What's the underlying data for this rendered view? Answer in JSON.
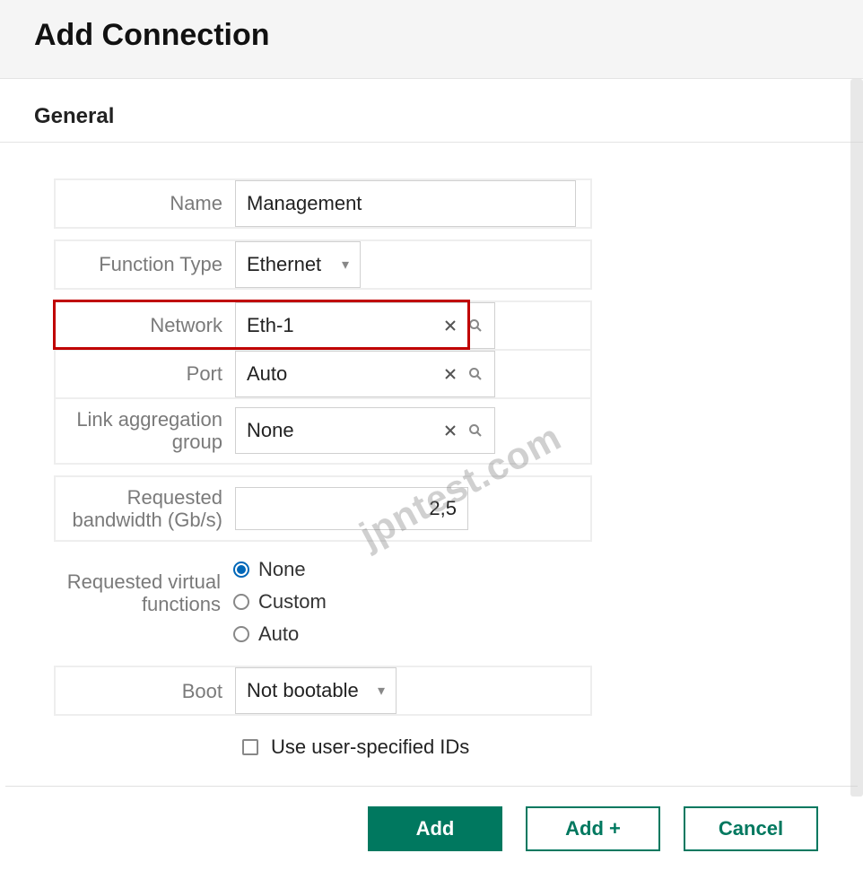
{
  "header": {
    "title": "Add Connection"
  },
  "section": {
    "title": "General"
  },
  "fields": {
    "name": {
      "label": "Name",
      "value": "Management"
    },
    "function_type": {
      "label": "Function Type",
      "value": "Ethernet"
    },
    "network": {
      "label": "Network",
      "value": "Eth-1"
    },
    "port": {
      "label": "Port",
      "value": "Auto"
    },
    "lag": {
      "label": "Link aggregation group",
      "value": "None"
    },
    "bandwidth": {
      "label": "Requested bandwidth (Gb/s)",
      "value": "2,5"
    },
    "rvf": {
      "label": "Requested virtual functions",
      "options": [
        "None",
        "Custom",
        "Auto"
      ],
      "selected": "None"
    },
    "boot": {
      "label": "Boot",
      "value": "Not bootable"
    },
    "use_ids": {
      "label": "Use user-specified IDs",
      "checked": false
    }
  },
  "footer": {
    "add": "Add",
    "add_plus": "Add +",
    "cancel": "Cancel"
  },
  "watermark": "jpntest.com"
}
